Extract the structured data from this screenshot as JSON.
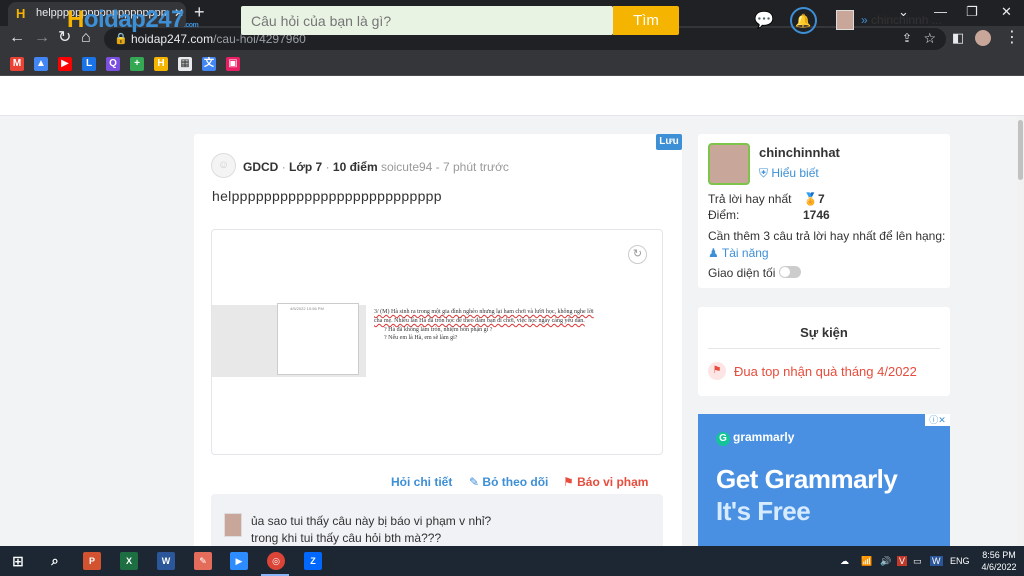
{
  "browser": {
    "tab_title": "helpppppppppppppppppppppppppp",
    "url_domain": "hoidap247.com",
    "url_path": "/cau-hoi/4297960"
  },
  "header": {
    "logo": "Hoidap247",
    "logo_sub": ".com",
    "search_placeholder": "Câu hỏi của bạn là gì?",
    "search_button": "Tìm",
    "username": "chinchinnh ..."
  },
  "question": {
    "save_label": "Lưu",
    "subject": "GDCD",
    "grade": "Lớp 7",
    "points": "10 điểm",
    "author_time": "soicute94 - 7 phút trước",
    "text": "helpppppppppppppppppppppppppp",
    "image_lines": [
      "3/ (M) Hà sinh ra trong một gia đình nghèo nhưng lại ham chơi và lười học, không nghe lời",
      "cha mẹ. Nhiều lần Hà đã trốn học để theo đám bạn đi chơi, việc học ngày càng yếu dần.",
      "? Hà đã không làm tròn, nhiệm  bổn phận gì ?",
      "? Nếu em là Hà, em sẽ làm gì?"
    ],
    "actions": {
      "detail": "Hỏi chi tiết",
      "unfollow": "Bỏ theo dõi",
      "report": "Báo vi phạm"
    }
  },
  "comment": {
    "line1": "ủa sao tui thấy câu này bị báo vi phạm v nhỉ?",
    "line2": "trong khi tui thấy câu hỏi bth mà???"
  },
  "profile": {
    "name": "chinchinnhat",
    "rank": "Hiểu biết",
    "best_answers_label": "Trả lời hay nhất",
    "best_answers_value": "7",
    "points_label": "Điểm:",
    "points_value": "1746",
    "next_level": "Cần thêm 3 câu trả lời hay nhất để lên hạng:",
    "next_rank": "Tài năng",
    "dark_mode_label": "Giao diện tối"
  },
  "events": {
    "title": "Sự kiện",
    "item": "Đua top nhận quà tháng 4/2022"
  },
  "ad": {
    "brand": "grammarly",
    "headline1": "Get Grammarly",
    "headline2": "It's Free"
  },
  "taskbar": {
    "lang": "ENG",
    "time": "8:56 PM",
    "date": "4/6/2022"
  },
  "colors": {
    "brand_blue": "#3d8fd6",
    "brand_yellow": "#f5b400",
    "report_red": "#e74c3c"
  }
}
